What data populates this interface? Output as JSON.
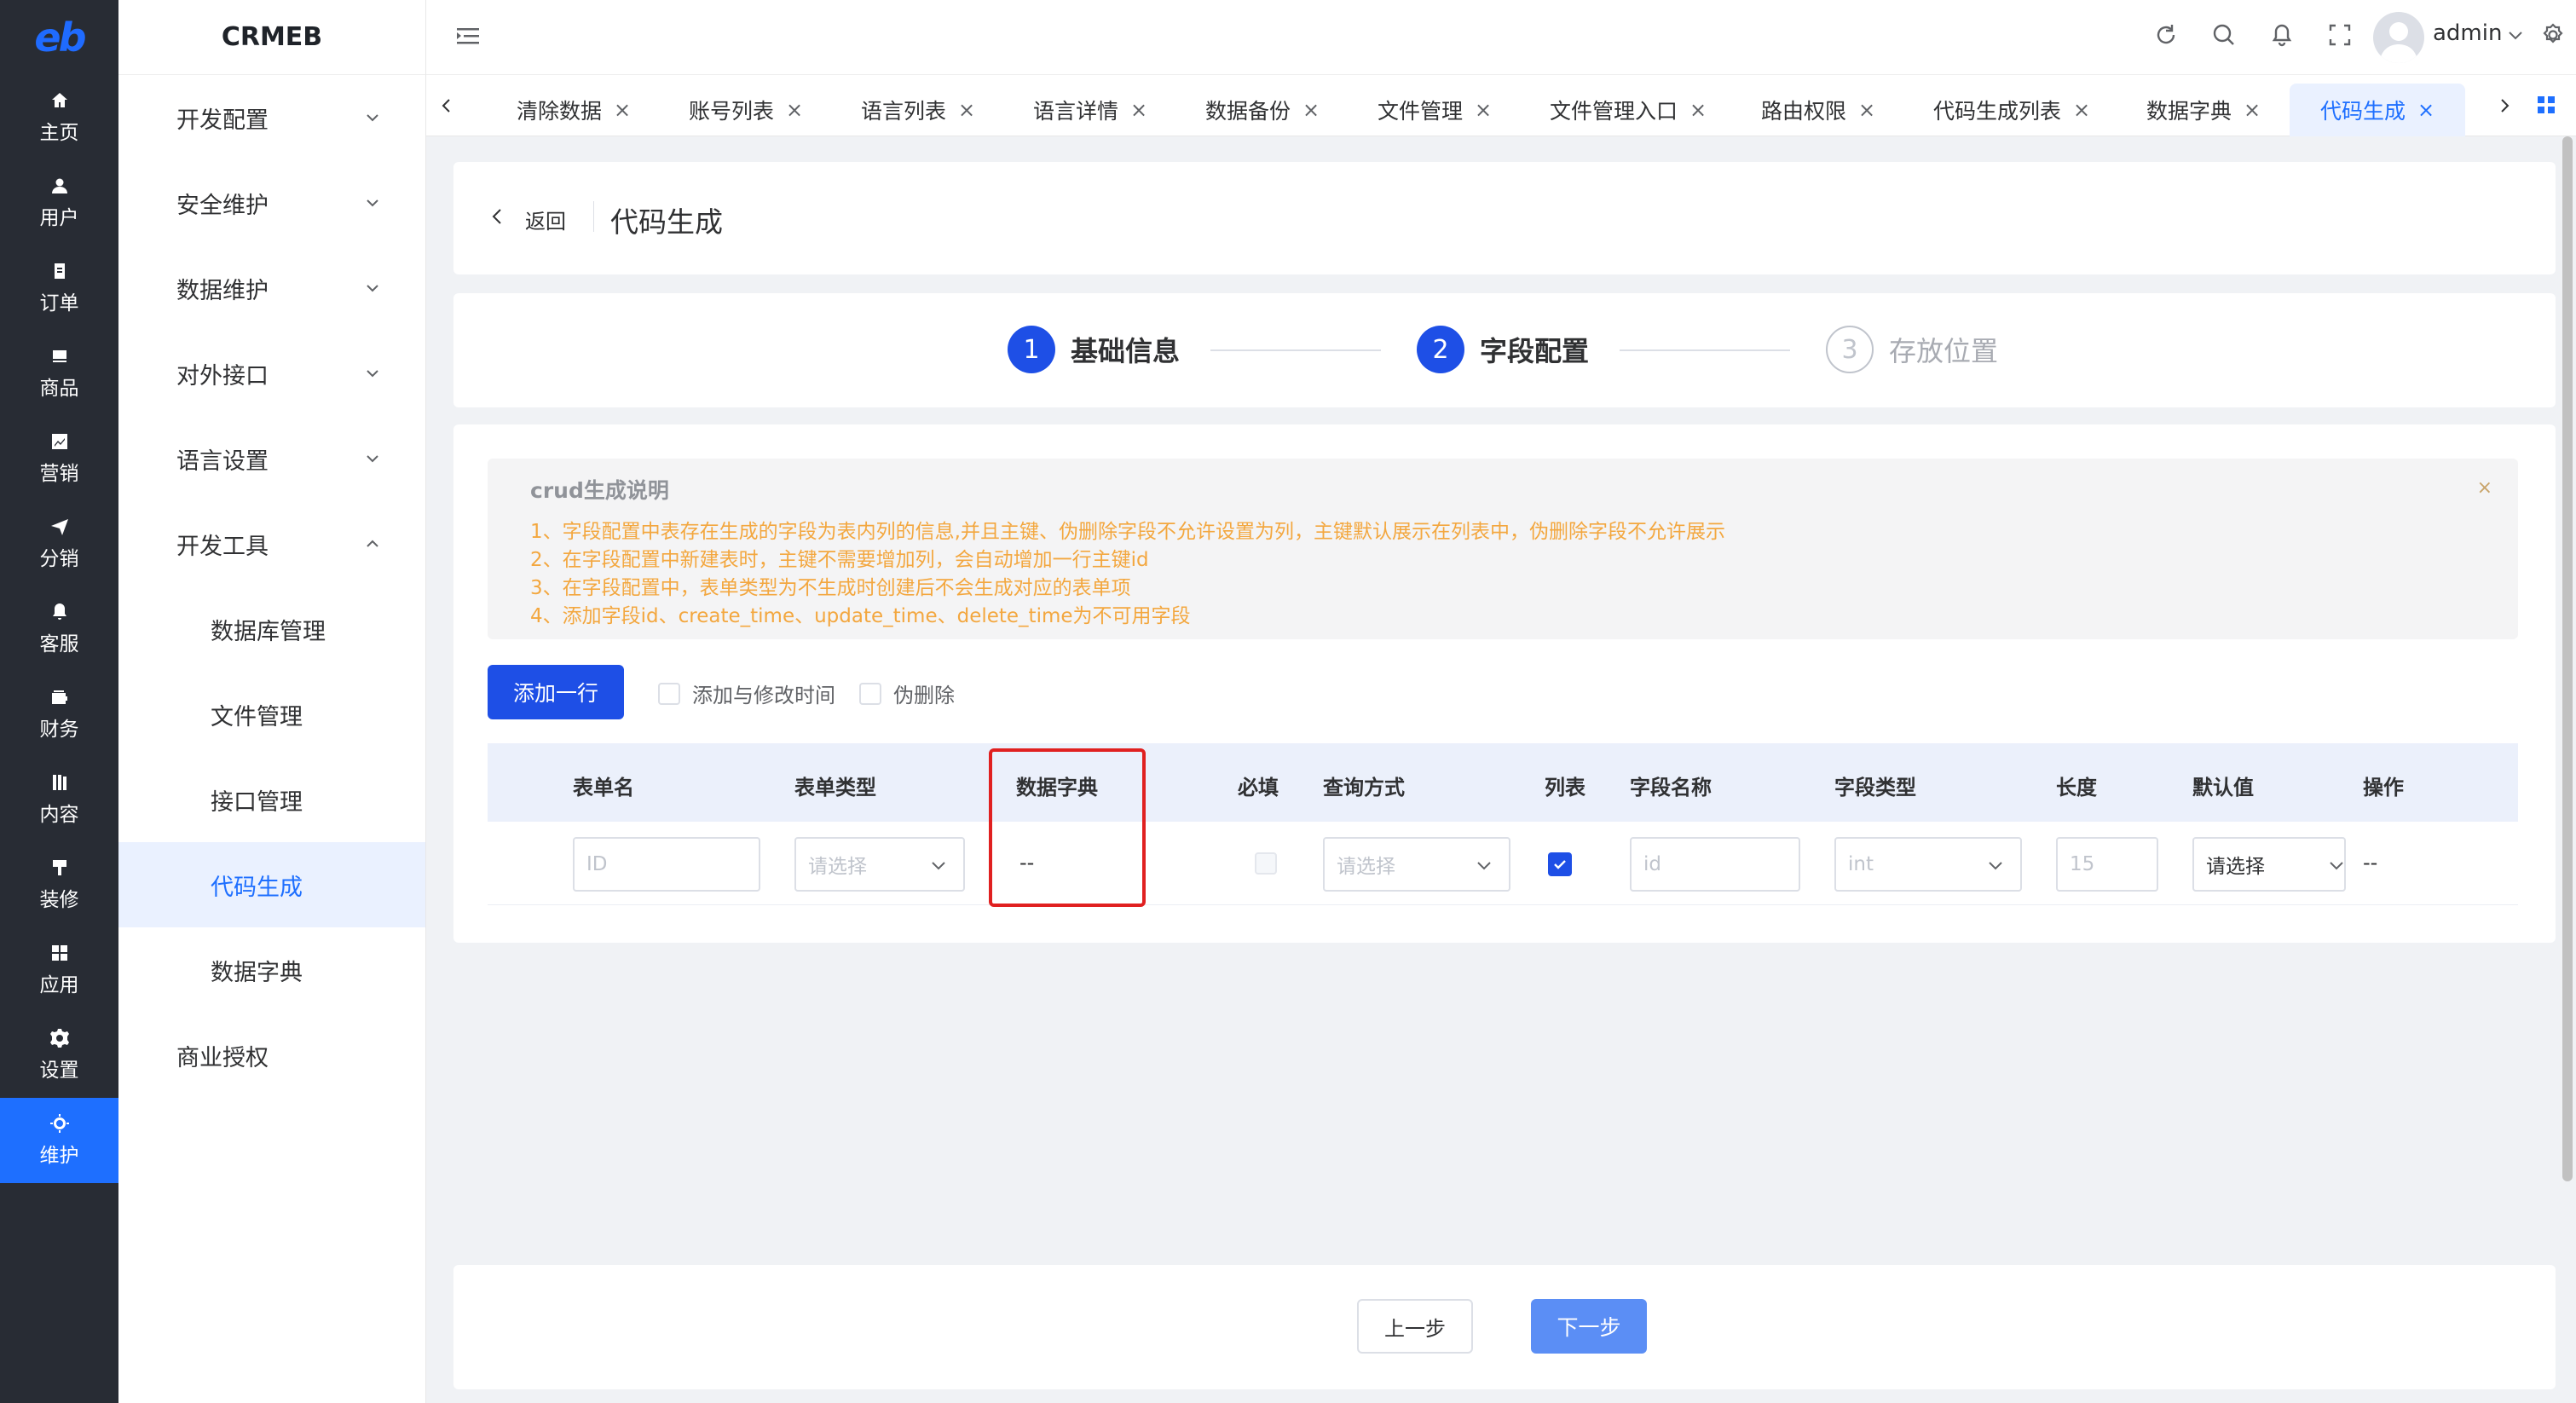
{
  "rail": {
    "logo": "eb",
    "items": [
      {
        "label": "主页",
        "icon": "home-icon"
      },
      {
        "label": "用户",
        "icon": "user-icon"
      },
      {
        "label": "订单",
        "icon": "order-icon"
      },
      {
        "label": "商品",
        "icon": "goods-icon"
      },
      {
        "label": "营销",
        "icon": "marketing-icon"
      },
      {
        "label": "分销",
        "icon": "send-icon"
      },
      {
        "label": "客服",
        "icon": "bell-icon"
      },
      {
        "label": "财务",
        "icon": "wallet-icon"
      },
      {
        "label": "内容",
        "icon": "content-icon"
      },
      {
        "label": "装修",
        "icon": "brush-icon"
      },
      {
        "label": "应用",
        "icon": "apps-icon"
      },
      {
        "label": "设置",
        "icon": "gear-icon"
      },
      {
        "label": "维护",
        "icon": "maintenance-icon",
        "active": true
      }
    ]
  },
  "menu": {
    "brand": "CRMEB",
    "groups": [
      {
        "label": "开发配置"
      },
      {
        "label": "安全维护"
      },
      {
        "label": "数据维护"
      },
      {
        "label": "对外接口"
      },
      {
        "label": "语言设置"
      },
      {
        "label": "开发工具",
        "expanded": true
      }
    ],
    "sub_items": [
      {
        "label": "数据库管理"
      },
      {
        "label": "文件管理"
      },
      {
        "label": "接口管理"
      },
      {
        "label": "代码生成",
        "active": true
      },
      {
        "label": "数据字典"
      }
    ],
    "last_group": "商业授权"
  },
  "header": {
    "user": "admin"
  },
  "tabs": [
    {
      "label": "清除数据"
    },
    {
      "label": "账号列表"
    },
    {
      "label": "语言列表"
    },
    {
      "label": "语言详情"
    },
    {
      "label": "数据备份"
    },
    {
      "label": "文件管理"
    },
    {
      "label": "文件管理入口"
    },
    {
      "label": "路由权限"
    },
    {
      "label": "代码生成列表"
    },
    {
      "label": "数据字典"
    },
    {
      "label": "代码生成",
      "active": true
    }
  ],
  "page": {
    "back": "返回",
    "title": "代码生成"
  },
  "steps": [
    {
      "num": "1",
      "label": "基础信息",
      "state": "done"
    },
    {
      "num": "2",
      "label": "字段配置",
      "state": "active"
    },
    {
      "num": "3",
      "label": "存放位置",
      "state": "pending"
    }
  ],
  "notice": {
    "title": "crud生成说明",
    "lines": [
      "1、字段配置中表存在生成的字段为表内列的信息,并且主键、伪删除字段不允许设置为列，主键默认展示在列表中，伪删除字段不允许展示",
      "2、在字段配置中新建表时，主键不需要增加列，会自动增加一行主键id",
      "3、在字段配置中，表单类型为不生成时创建后不会生成对应的表单项",
      "4、添加字段id、create_time、update_time、delete_time为不可用字段"
    ],
    "close": "×"
  },
  "toolbar": {
    "add_row": "添加一行",
    "chk_time": "添加与修改时间",
    "chk_soft_delete": "伪删除"
  },
  "table": {
    "headers": [
      "表单名",
      "表单类型",
      "数据字典",
      "必填",
      "查询方式",
      "列表",
      "字段名称",
      "字段类型",
      "长度",
      "默认值",
      "操作"
    ],
    "row": {
      "form_name_placeholder": "ID",
      "form_type_placeholder": "请选择",
      "dict": "--",
      "required": false,
      "query_placeholder": "请选择",
      "list": true,
      "field_name_placeholder": "id",
      "field_type": "int",
      "length_placeholder": "15",
      "default_value": "请选择",
      "operation": "--"
    }
  },
  "footer": {
    "prev": "上一步",
    "next": "下一步"
  },
  "colors": {
    "primary": "#1e4fe6",
    "warning": "#f3a73f",
    "rail_bg": "#282c34",
    "highlight": "#e02020"
  }
}
